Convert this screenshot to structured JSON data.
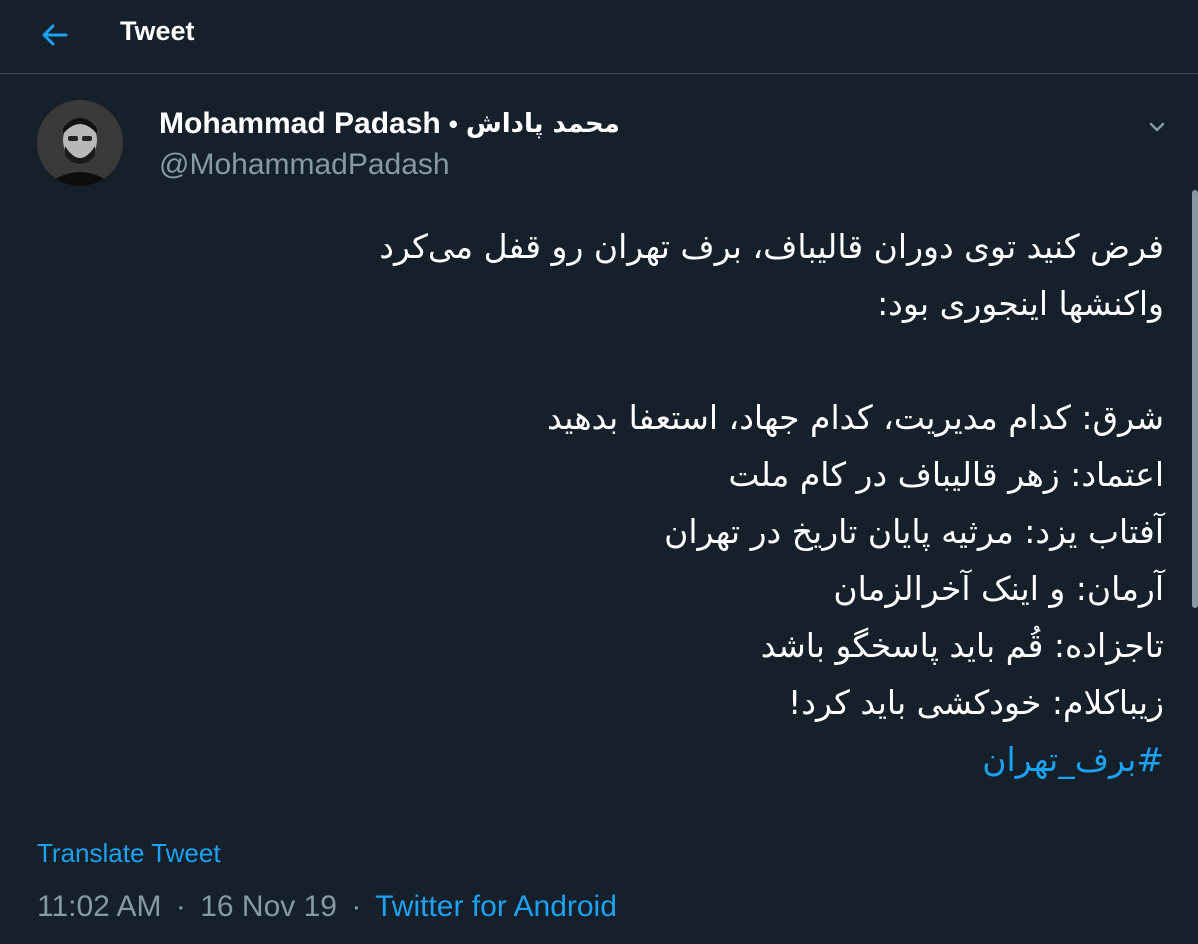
{
  "header": {
    "title": "Tweet"
  },
  "author": {
    "display_name": "Mohammad Padash",
    "separator": "•",
    "persian_name": "محمد پاداش",
    "handle": "@MohammadPadash"
  },
  "tweet": {
    "lines": [
      "فرض کنید توی دوران قالیباف، برف تهران رو قفل می‌کرد",
      "واکنشها اینجوری بود:",
      "",
      "شرق: کدام مدیریت، کدام جهاد، استعفا بدهید",
      "اعتماد: زهر قالیباف در کام ملت",
      "آفتاب یزد: مرثیه پایان تاریخ در تهران",
      "آرمان: و اینک آخرالزمان",
      "تاجزاده: قُم باید پاسخگو باشد",
      "زیباکلام: خودکشی باید کرد!"
    ],
    "hashtag": "#برف_تهران"
  },
  "translate_label": "Translate Tweet",
  "meta": {
    "time": "11:02 AM",
    "date": "16 Nov 19",
    "source": "Twitter for Android",
    "dot": "·"
  },
  "icons": {
    "back": "back-arrow-icon",
    "more": "chevron-down-icon"
  },
  "colors": {
    "background": "#15202b",
    "accent": "#1da1f2",
    "secondary": "#8899a6"
  }
}
